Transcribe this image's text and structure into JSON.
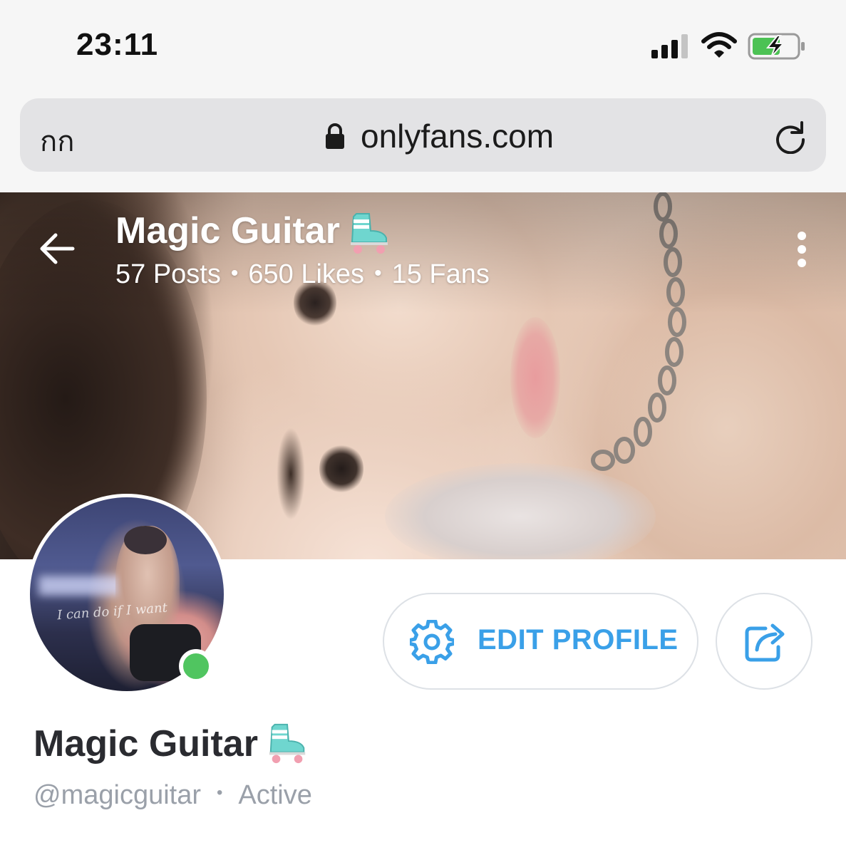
{
  "status_bar": {
    "time": "23:11",
    "icons": [
      "signal-icon",
      "wifi-icon",
      "battery-charging-icon"
    ]
  },
  "browser": {
    "reader_toggle": "กก",
    "url": "onlyfans.com",
    "icons": [
      "lock-icon",
      "reload-icon"
    ]
  },
  "header": {
    "name": "Magic Guitar",
    "name_emoji": "roller-skate-icon",
    "stats": {
      "posts": "57 Posts",
      "likes": "650 Likes",
      "fans": "15 Fans",
      "separator": "•"
    },
    "icons": [
      "back-arrow-icon",
      "more-vertical-icon"
    ]
  },
  "avatar": {
    "status": "online",
    "status_color": "#50c560",
    "caption": "I can do if I want"
  },
  "actions": {
    "edit_profile_label": "EDIT PROFILE",
    "edit_icon": "gear-icon",
    "share_icon": "share-icon",
    "accent_color": "#3aa0e8"
  },
  "profile": {
    "name": "Magic Guitar",
    "name_emoji": "roller-skate-icon",
    "handle": "@magicguitar",
    "separator": "•",
    "status": "Active"
  }
}
